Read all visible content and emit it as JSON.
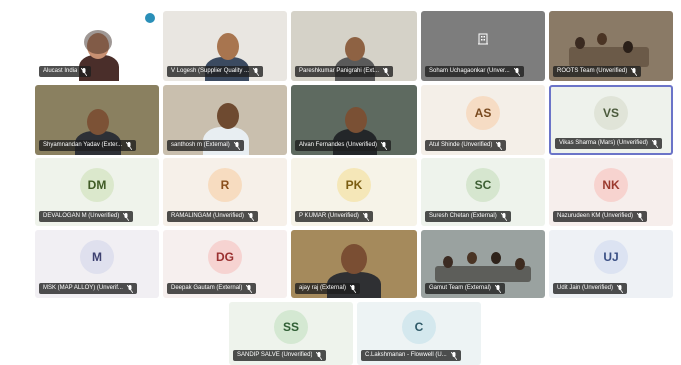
{
  "meeting": {
    "colors": {
      "tile_bg_light": "#eef3ec",
      "name_bar": "#1e1e1e",
      "selected_border": "#6b74c8"
    },
    "participants": [
      {
        "name": "Alucast India",
        "kind": "video",
        "icon": "presentation-slide"
      },
      {
        "name": "V Logesh (Supplier Quality ...",
        "kind": "video"
      },
      {
        "name": "Pareshkumar Panigrahi (Ext...",
        "kind": "video"
      },
      {
        "name": "Soham Uchagaonkar (Unver...",
        "kind": "placeholder",
        "icon": "building-icon"
      },
      {
        "name": "ROOTS Team (Unverified)",
        "kind": "video"
      },
      {
        "name": "Shyamnandan Yadav (Exter...",
        "kind": "video"
      },
      {
        "name": "santhosh m (External)",
        "kind": "video"
      },
      {
        "name": "Alvan Fernandes (Unverified)",
        "kind": "video"
      },
      {
        "name": "Atul Shinde (Unverified)",
        "kind": "avatar",
        "initials": "AS",
        "avatar_bg": "#f6dcc4",
        "avatar_fg": "#7a4a1f"
      },
      {
        "name": "Vikas Sharma (Mars) (Unverified)",
        "kind": "avatar",
        "initials": "VS",
        "avatar_bg": "#e0e4d8",
        "avatar_fg": "#4b5a3c",
        "selected": true
      },
      {
        "name": "DEVALOGAN M (Unverified)",
        "kind": "avatar",
        "initials": "DM",
        "avatar_bg": "#dbe8cc",
        "avatar_fg": "#3f5b25"
      },
      {
        "name": "RAMALINGAM (Unverified)",
        "kind": "avatar",
        "initials": "R",
        "avatar_bg": "#f7dcc0",
        "avatar_fg": "#8a4f1c"
      },
      {
        "name": "P KUMAR (Unverified)",
        "kind": "avatar",
        "initials": "PK",
        "avatar_bg": "#f5e7b8",
        "avatar_fg": "#7a5d12"
      },
      {
        "name": "Suresh Chetan (External)",
        "kind": "avatar",
        "initials": "SC",
        "avatar_bg": "#d6e6cf",
        "avatar_fg": "#3f6035"
      },
      {
        "name": "Nazurudeen KM (Unverified)",
        "kind": "avatar",
        "initials": "NK",
        "avatar_bg": "#f7d3cf",
        "avatar_fg": "#9b3a2e"
      },
      {
        "name": "MSK (MAP ALLOY) (Unverif...",
        "kind": "avatar",
        "initials": "M",
        "avatar_bg": "#dfe0ee",
        "avatar_fg": "#3d4070"
      },
      {
        "name": "Deepak Gautam (External)",
        "kind": "avatar",
        "initials": "DG",
        "avatar_bg": "#f6d3d1",
        "avatar_fg": "#9a3030"
      },
      {
        "name": "ajay raj (External)",
        "kind": "video"
      },
      {
        "name": "Gamut Team (External)",
        "kind": "video"
      },
      {
        "name": "Udit Jain (Unverified)",
        "kind": "avatar",
        "initials": "UJ",
        "avatar_bg": "#dce3f2",
        "avatar_fg": "#3a4f84"
      },
      {
        "name": "SANDIP SALVE (Unverified)",
        "kind": "avatar",
        "initials": "SS",
        "avatar_bg": "#d4e8d2",
        "avatar_fg": "#2f5e34"
      },
      {
        "name": "C.Lakshmanan - Flowwell (U...",
        "kind": "avatar",
        "initials": "C",
        "avatar_bg": "#d4e8ee",
        "avatar_fg": "#2f5a68"
      }
    ]
  }
}
